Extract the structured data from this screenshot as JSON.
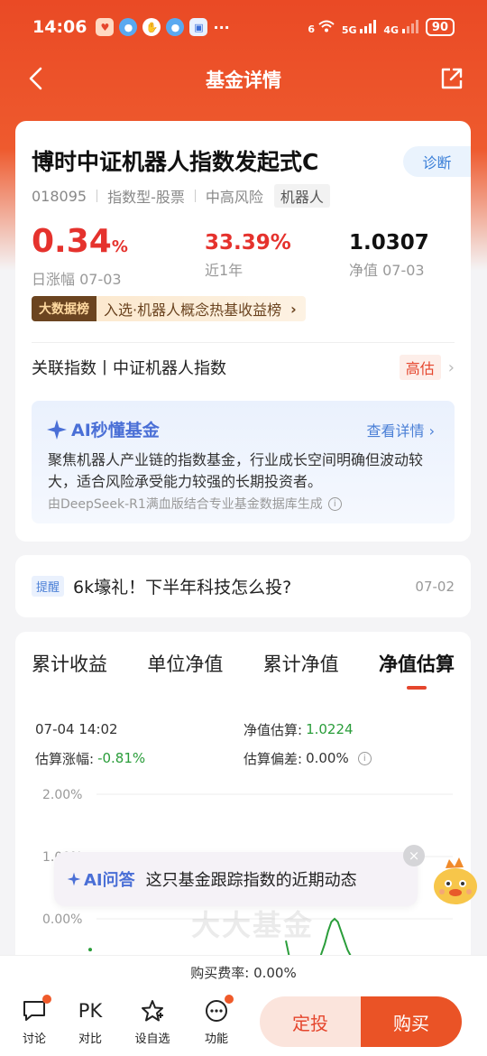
{
  "status_bar": {
    "time": "14:06",
    "more": "···",
    "wifi_label": "6",
    "net1": "5G",
    "net2": "4G",
    "battery": "90"
  },
  "nav": {
    "title": "基金详情"
  },
  "fund": {
    "name": "博时中证机器人指数发起式C",
    "diagnose_label": "诊断",
    "code": "018095",
    "type": "指数型-股票",
    "risk": "中高风险",
    "theme_tag": "机器人",
    "daily_change_value": "0.34",
    "daily_change_unit": "%",
    "daily_change_label": "日涨幅 07-03",
    "year_change": "33.39%",
    "year_change_label": "近1年",
    "nav_value": "1.0307",
    "nav_label": "净值 07-03",
    "rank_tag": "大数据榜",
    "rank_text": "入选·机器人概念热基收益榜",
    "index_text": "关联指数丨中证机器人指数",
    "valuation_tag": "高估"
  },
  "ai_card": {
    "title": "AI秒懂基金",
    "more": "查看详情",
    "body": "聚焦机器人产业链的指数基金，行业成长空间明确但波动较大，适合风险承受能力较强的长期投资者。",
    "source": "由DeepSeek-R1满血版结合专业基金数据库生成"
  },
  "notice": {
    "tag": "提醒",
    "text": "6k壕礼！下半年科技怎么投?",
    "date": "07-02"
  },
  "chart_tabs": [
    "累计收益",
    "单位净值",
    "累计净值",
    "净值估算"
  ],
  "estimate": {
    "time": "07-04 14:02",
    "nav_est_label": "净值估算:",
    "nav_est_value": "1.0224",
    "change_label": "估算涨幅:",
    "change_value": "-0.81%",
    "deviation_label": "估算偏差:",
    "deviation_value": "0.00%"
  },
  "chart_data": {
    "type": "line",
    "y_tick_labels": [
      "2.00%",
      "1.00%",
      "0.00%"
    ],
    "ylim": [
      -1.0,
      2.0
    ],
    "series": [
      {
        "values": [
          -0.35,
          -0.6,
          -0.75,
          -0.8,
          -0.8,
          -0.8,
          -0.8,
          -0.8,
          -0.8,
          -0.75,
          -0.7,
          -0.55,
          -0.4,
          -0.2,
          -0.05,
          0.0,
          -0.05,
          -0.2,
          -0.35,
          -0.5,
          -0.6
        ]
      }
    ],
    "colors": {
      "line": "#2a9d3a"
    }
  },
  "ai_bubble": {
    "key": "AI问答",
    "question": "这只基金跟踪指数的近期动态"
  },
  "watermark": "大大基金",
  "fee": "购买费率: 0.00%",
  "bottom": {
    "discuss": "讨论",
    "pk_glyph": "PK",
    "compare": "对比",
    "watchlist": "设自选",
    "functions": "功能",
    "plan": "定投",
    "buy": "购买"
  },
  "colors": {
    "brand": "#ea4a25",
    "rise": "#e5322d",
    "fall": "#2a9d3a",
    "ai_blue": "#4a6fd6"
  }
}
